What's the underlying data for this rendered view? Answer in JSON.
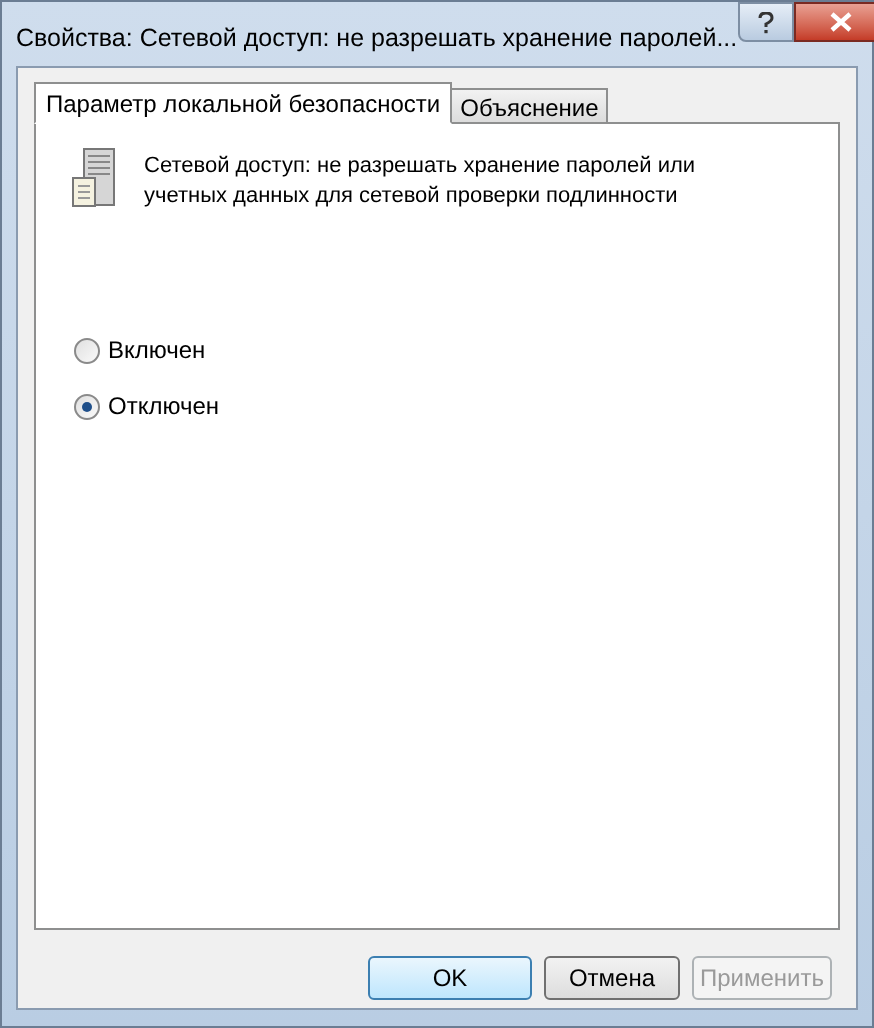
{
  "window": {
    "title": "Свойства: Сетевой доступ: не разрешать хранение паролей..."
  },
  "tabs": [
    {
      "label": "Параметр локальной безопасности",
      "selected": true
    },
    {
      "label": "Объяснение",
      "selected": false
    }
  ],
  "policy": {
    "description": "Сетевой доступ: не разрешать хранение паролей или учетных данных для сетевой проверки подлинности"
  },
  "options": [
    {
      "label": "Включен",
      "selected": false
    },
    {
      "label": "Отключен",
      "selected": true
    }
  ],
  "buttons": [
    {
      "label": "OK",
      "default": true,
      "disabled": false
    },
    {
      "label": "Отмена",
      "default": false,
      "disabled": false
    },
    {
      "label": "Применить",
      "default": false,
      "disabled": true
    }
  ]
}
